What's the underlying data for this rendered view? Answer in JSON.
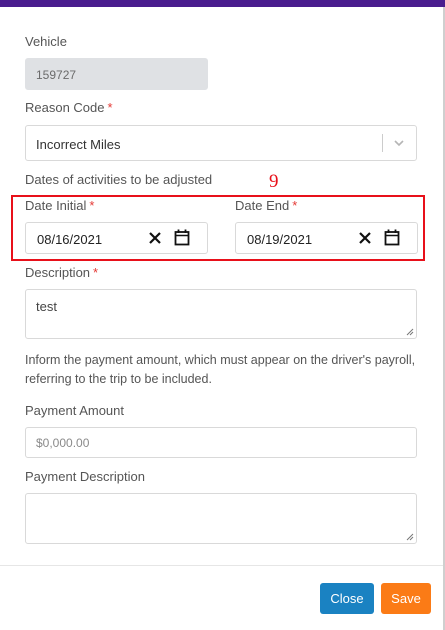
{
  "form": {
    "vehicle": {
      "label": "Vehicle",
      "value": "159727"
    },
    "reason_code": {
      "label": "Reason Code",
      "required_mark": "*",
      "value": "Incorrect Miles",
      "icon": "chevron-down-icon"
    },
    "dates_heading": "Dates of activities to be adjusted",
    "date_initial": {
      "label": "Date Initial",
      "required_mark": "*",
      "value": "08/16/2021",
      "clear_icon": "close-icon",
      "calendar_icon": "calendar-icon"
    },
    "date_end": {
      "label": "Date End",
      "required_mark": "*",
      "value": "08/19/2021",
      "clear_icon": "close-icon",
      "calendar_icon": "calendar-icon"
    },
    "description": {
      "label": "Description",
      "required_mark": "*",
      "value": "test"
    },
    "help_text": "Inform the payment amount, which must appear on the driver's payroll, referring to the trip to be included.",
    "payment_amount": {
      "label": "Payment Amount",
      "placeholder": "$0,000.00"
    },
    "payment_description": {
      "label": "Payment Description",
      "value": ""
    }
  },
  "annotation": {
    "number": "9",
    "color": "#e8101a"
  },
  "footer": {
    "close_label": "Close",
    "save_label": "Save"
  },
  "colors": {
    "header_bar": "#4a1d8e",
    "close_button": "#1a82c2",
    "save_button": "#fb7b16",
    "required": "#e53935"
  }
}
